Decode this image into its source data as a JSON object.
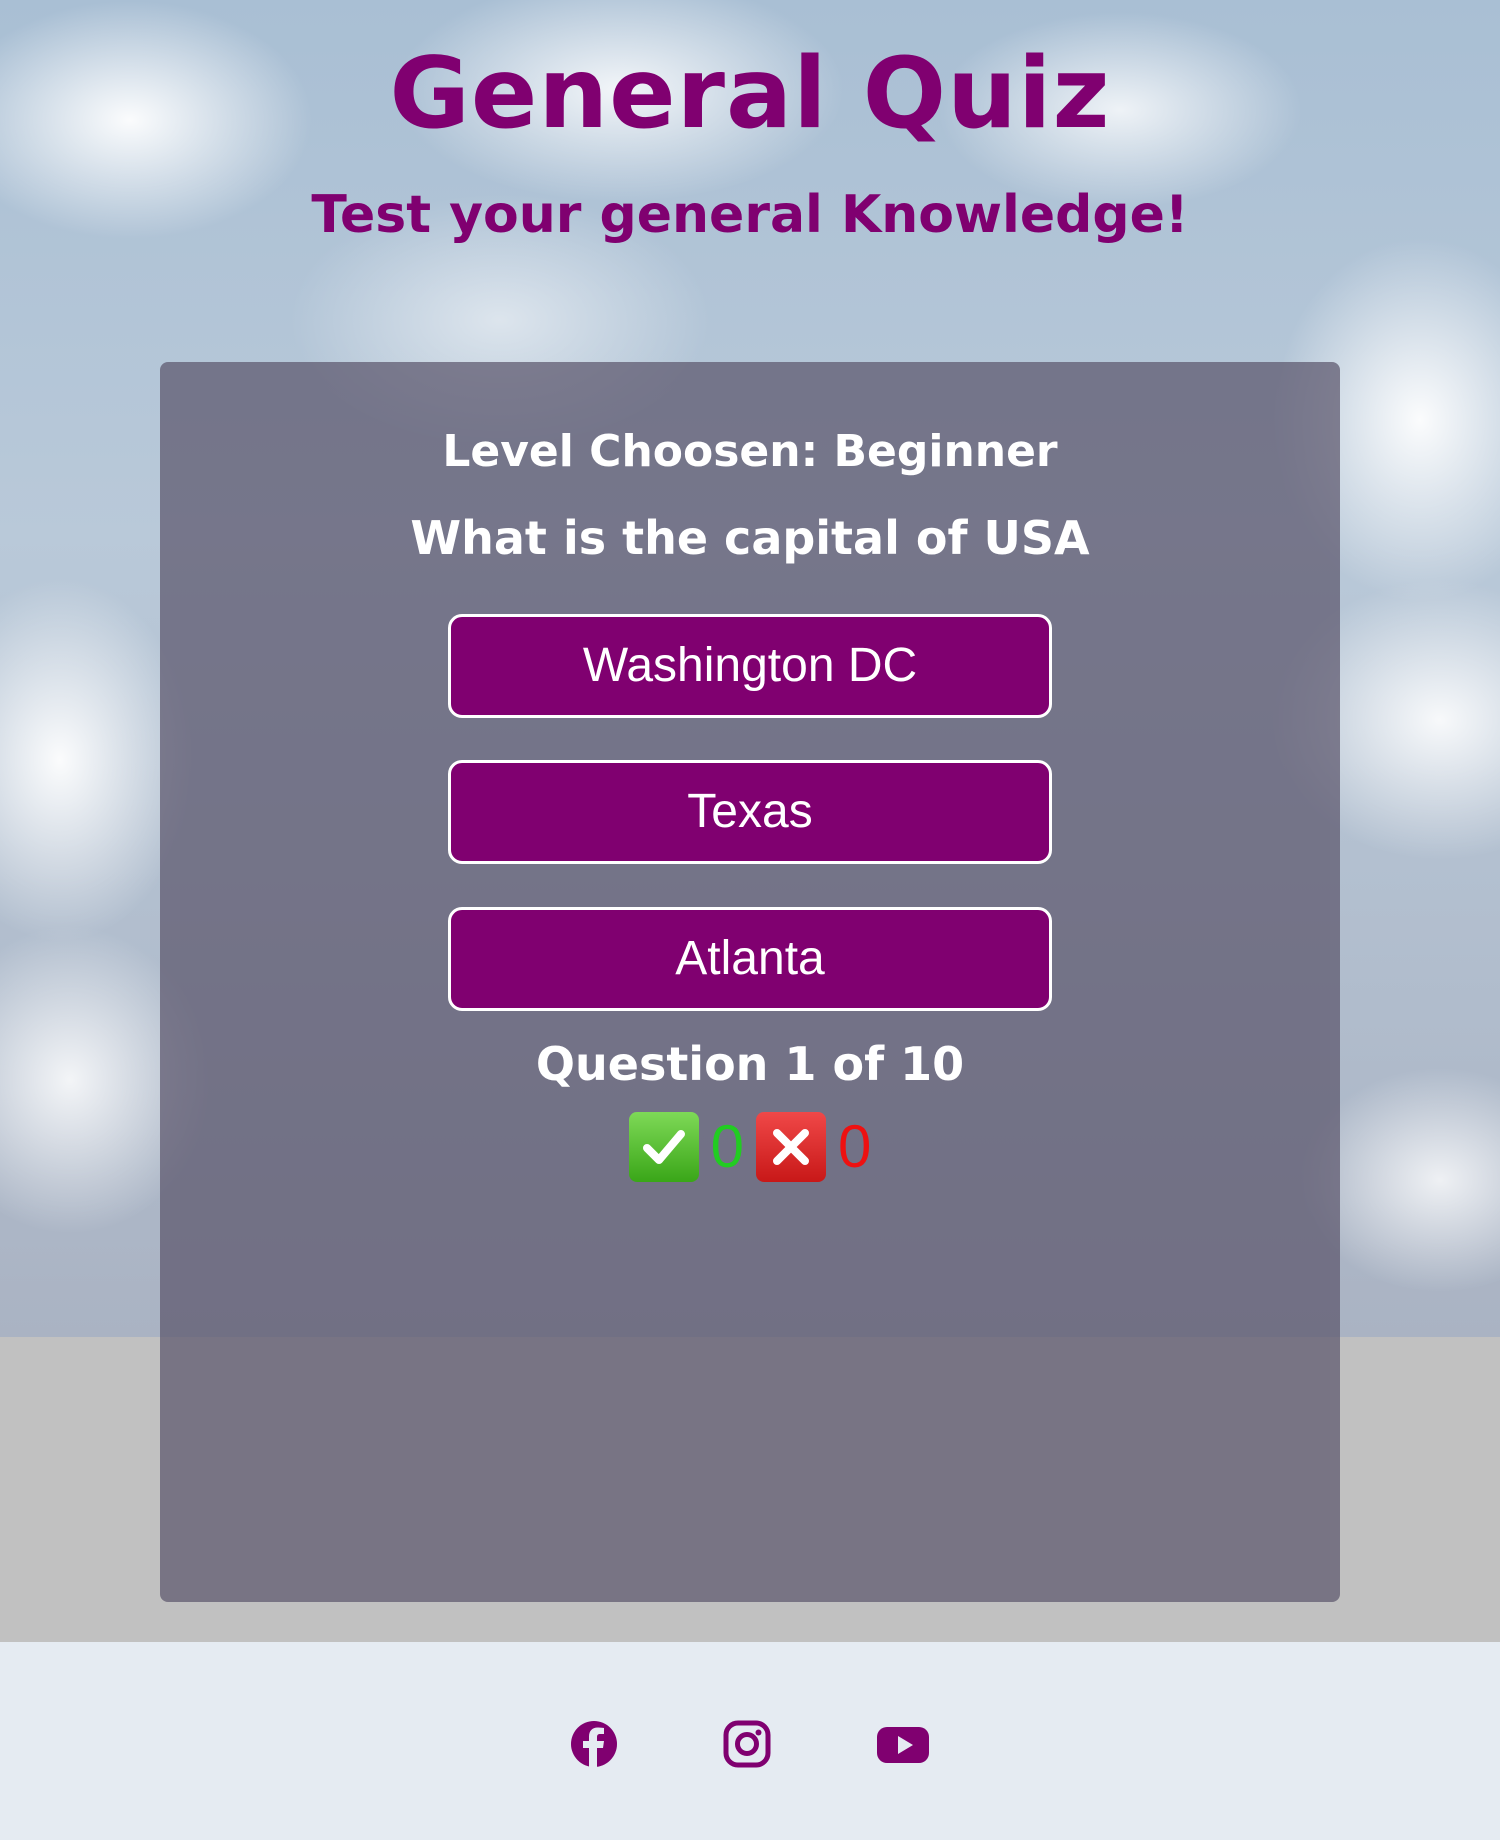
{
  "header": {
    "title": "General Quiz",
    "subtitle": "Test your general Knowledge!"
  },
  "quiz": {
    "level": "Level Choosen: Beginner",
    "question": "What is the capital of USA",
    "answers": [
      "Washington DC",
      "Texas",
      "Atlanta"
    ],
    "progress": "Question 1 of 10",
    "score": {
      "correct": "0",
      "incorrect": "0",
      "correct_icon": "check-mark-icon",
      "incorrect_icon": "cross-mark-icon"
    }
  },
  "footer": {
    "social": [
      "facebook-icon",
      "instagram-icon",
      "youtube-icon"
    ]
  },
  "colors": {
    "brand": "#800070",
    "correct": "#22cc22",
    "incorrect": "#ee1111",
    "footer_bg": "#e5ebf2"
  }
}
